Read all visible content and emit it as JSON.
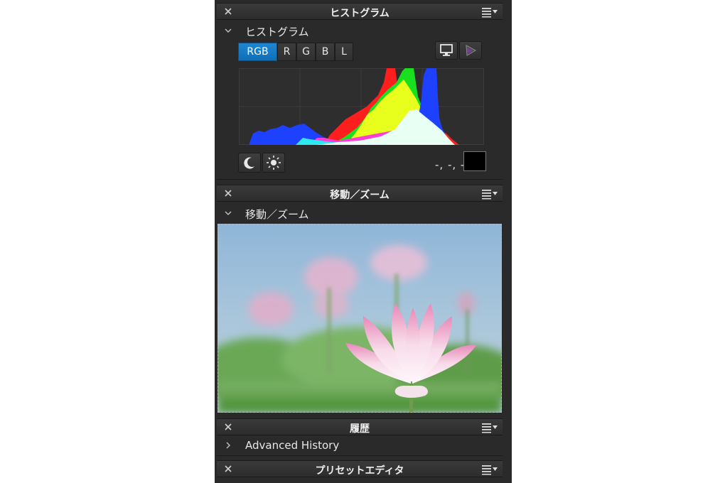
{
  "panels": {
    "histogram": {
      "header_title": "ヒストグラム",
      "section_label": "ヒストグラム",
      "channels": [
        "RGB",
        "R",
        "G",
        "B",
        "L"
      ],
      "active_channel": "RGB",
      "readout": "-, -, -",
      "swatch_color": "#000000"
    },
    "navigator": {
      "header_title": "移動／ズーム",
      "section_label": "移動／ズーム"
    },
    "history": {
      "header_title": "履歴",
      "section_label": "Advanced History"
    },
    "preset_editor": {
      "header_title": "プリセットエディタ"
    }
  },
  "icons": {
    "close": "close-icon",
    "menu": "panel-menu-icon",
    "expand": "chevron-down-icon",
    "collapse": "chevron-right-icon",
    "monitor": "monitor-icon",
    "gamut": "color-gamut-icon",
    "shadow": "moon-icon",
    "highlight": "sun-icon"
  },
  "colors": {
    "accent": "#1378c2",
    "panel_bg": "#2a2a2a"
  }
}
